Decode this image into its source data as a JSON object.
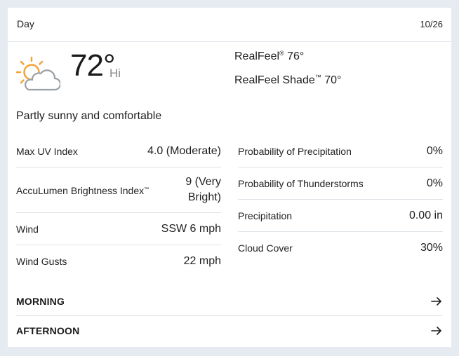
{
  "header": {
    "title": "Day",
    "date": "10/26"
  },
  "current": {
    "icon": "partly-sunny-icon",
    "temperature": "72°",
    "temp_label": "Hi",
    "realfeel_label": "RealFeel",
    "realfeel_tm": "®",
    "realfeel_value": "76°",
    "realfeel_shade_label": "RealFeel Shade",
    "realfeel_shade_tm": "™",
    "realfeel_shade_value": "70°",
    "phrase": "Partly sunny and comfortable"
  },
  "details_left": [
    {
      "label": "Max UV Index",
      "value": "4.0 (Moderate)"
    },
    {
      "label": "AccuLumen Brightness Index",
      "label_tm": "™",
      "value": "9 (Very Bright)"
    },
    {
      "label": "Wind",
      "value": "SSW 6 mph"
    },
    {
      "label": "Wind Gusts",
      "value": "22 mph"
    }
  ],
  "details_right": [
    {
      "label": "Probability of Precipitation",
      "value": "0%"
    },
    {
      "label": "Probability of Thunderstorms",
      "value": "0%"
    },
    {
      "label": "Precipitation",
      "value": "0.00 in"
    },
    {
      "label": "Cloud Cover",
      "value": "30%"
    }
  ],
  "nav": {
    "morning": "MORNING",
    "afternoon": "AFTERNOON",
    "arrow_icon": "arrow-right-icon"
  },
  "colors": {
    "background": "#e5ebf1",
    "card": "#ffffff",
    "sun": "#f5a033",
    "cloud_outline": "#9aa0a6"
  }
}
